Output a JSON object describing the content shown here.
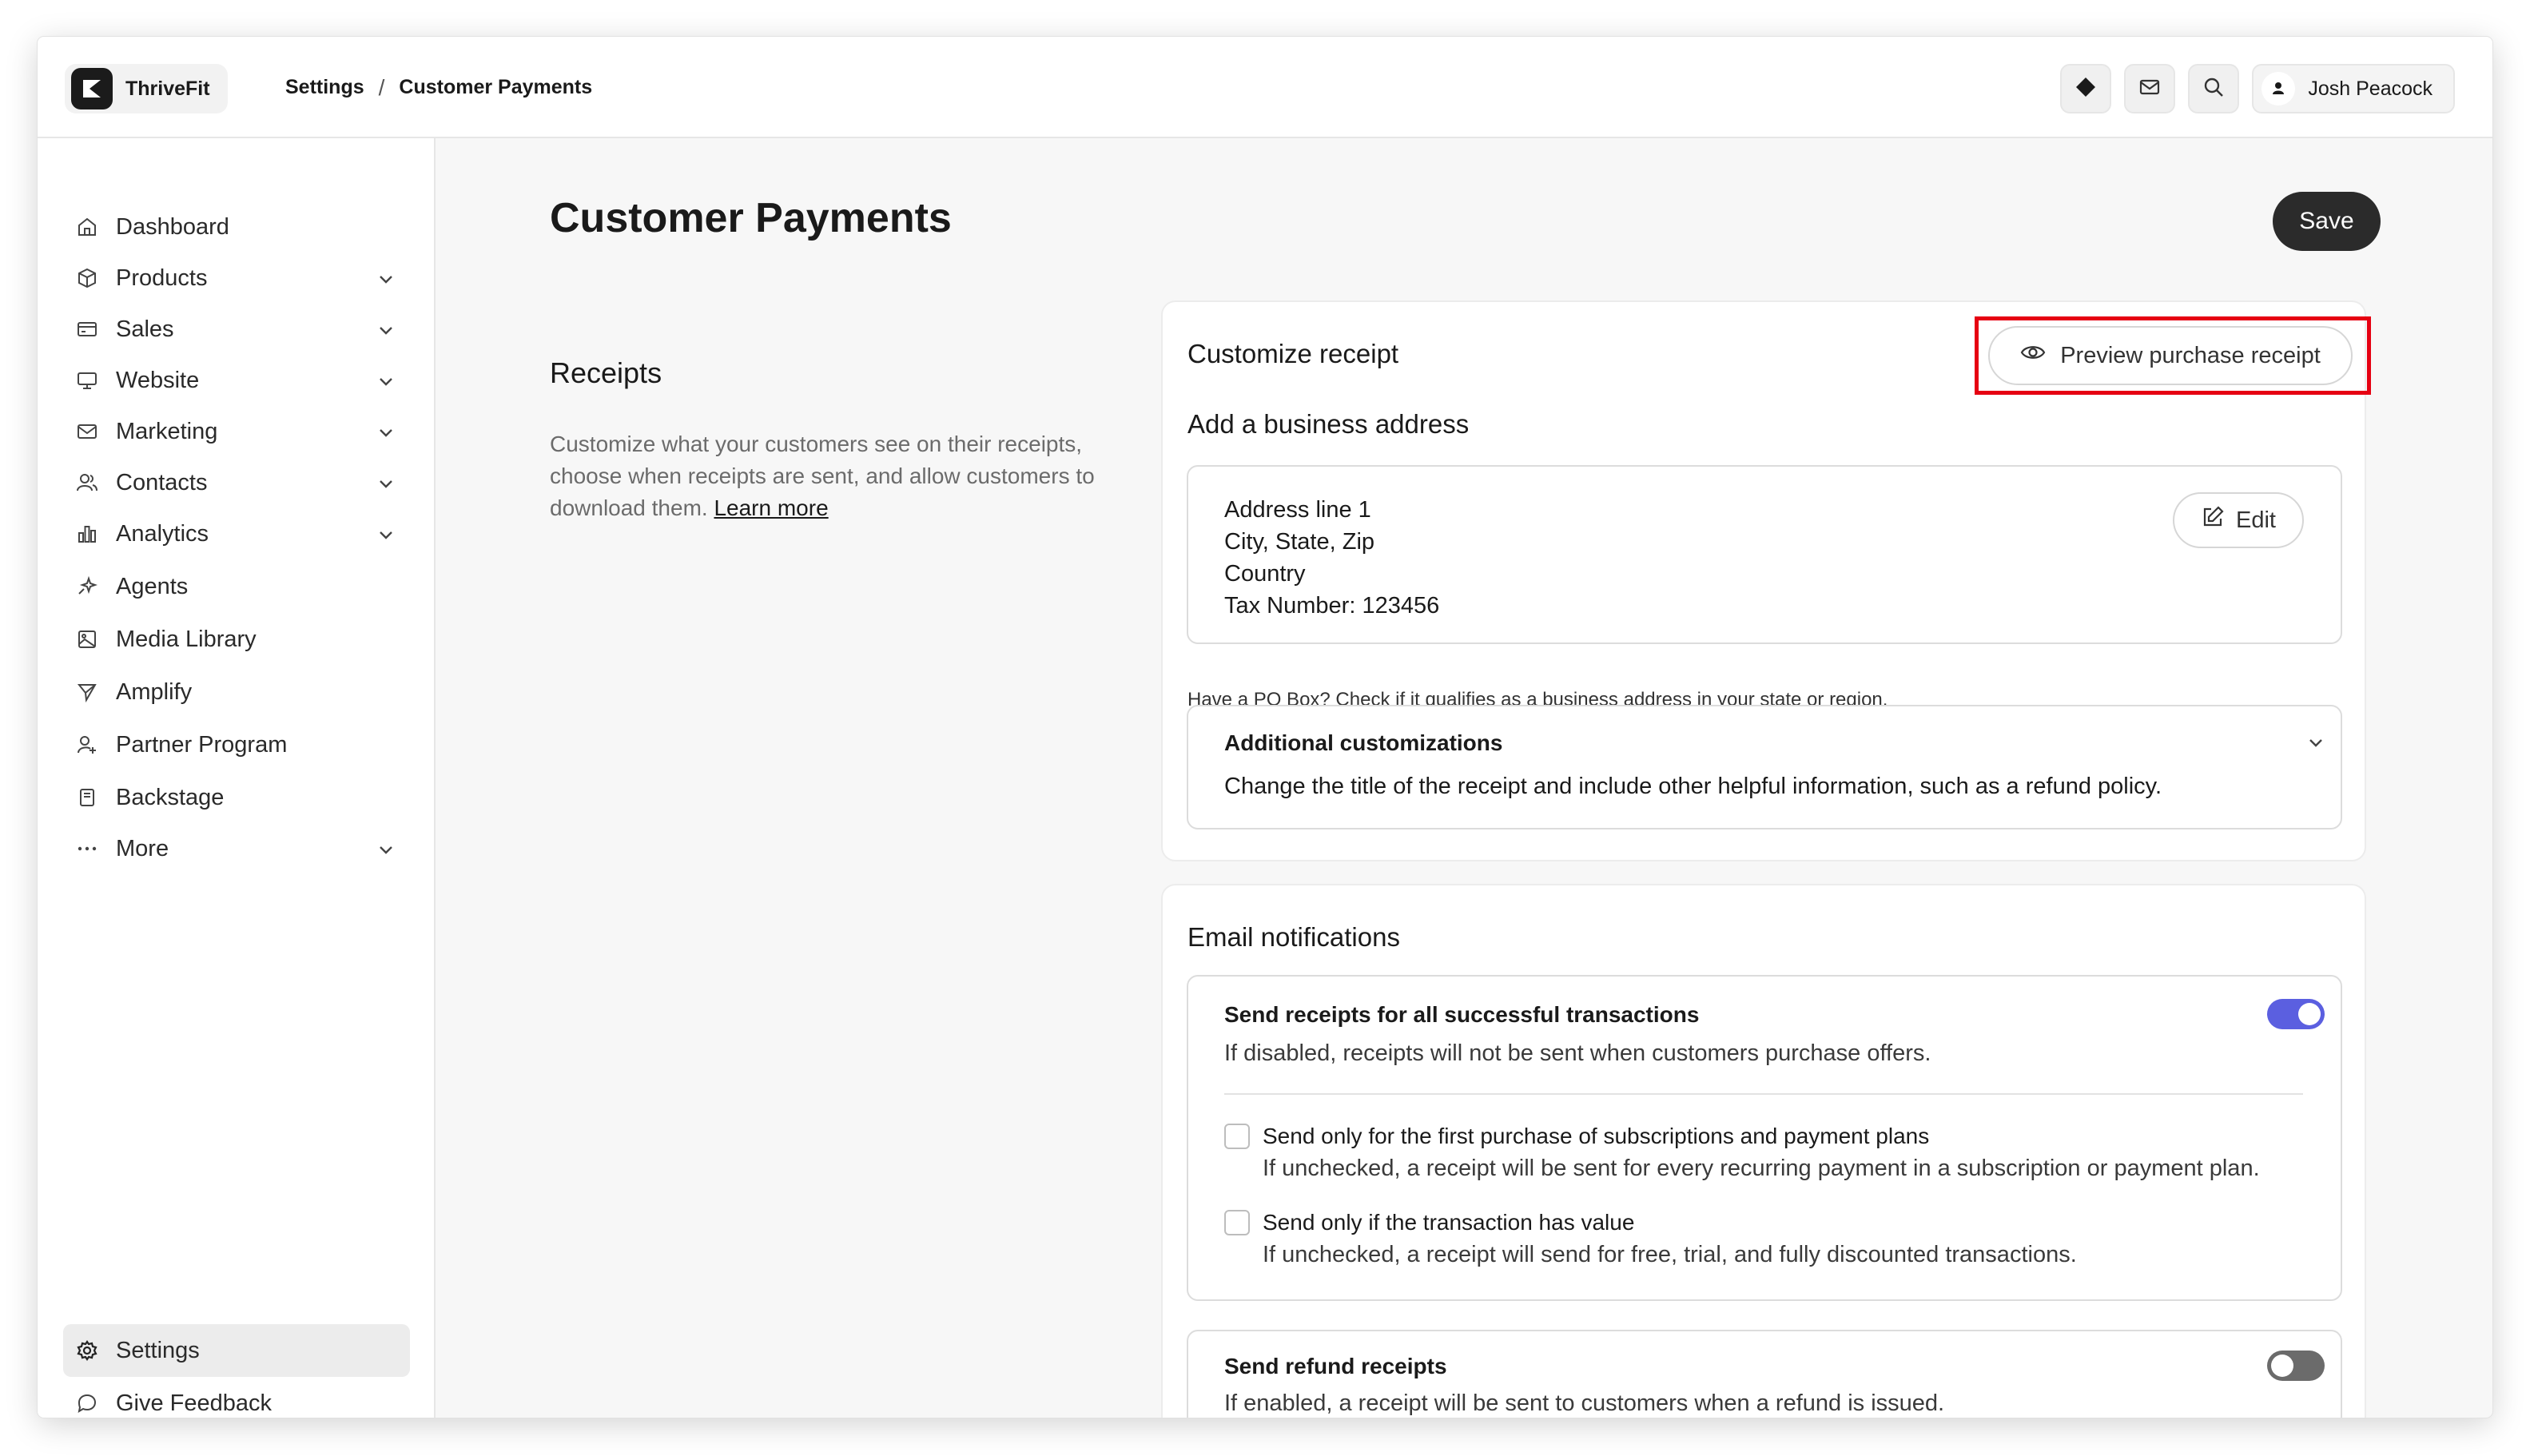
{
  "app": {
    "name": "ThriveFit"
  },
  "breadcrumb": {
    "items": [
      "Settings",
      "Customer Payments"
    ],
    "separator": "/"
  },
  "header": {
    "user_name": "Josh Peacock",
    "icons": [
      "diamond-icon",
      "mail-icon",
      "search-icon",
      "user-icon"
    ]
  },
  "sidebar": {
    "items": [
      {
        "label": "Dashboard",
        "icon": "home-icon",
        "chevron": false
      },
      {
        "label": "Products",
        "icon": "box-icon",
        "chevron": true
      },
      {
        "label": "Sales",
        "icon": "card-icon",
        "chevron": true
      },
      {
        "label": "Website",
        "icon": "monitor-icon",
        "chevron": true
      },
      {
        "label": "Marketing",
        "icon": "mail-icon",
        "chevron": true
      },
      {
        "label": "Contacts",
        "icon": "users-icon",
        "chevron": true
      },
      {
        "label": "Analytics",
        "icon": "chart-icon",
        "chevron": true
      },
      {
        "label": "Agents",
        "icon": "sparkle-icon",
        "chevron": false
      },
      {
        "label": "Media Library",
        "icon": "image-icon",
        "chevron": false
      },
      {
        "label": "Amplify",
        "icon": "send-icon",
        "chevron": false
      },
      {
        "label": "Partner Program",
        "icon": "partner-icon",
        "chevron": false
      },
      {
        "label": "Backstage",
        "icon": "book-icon",
        "chevron": false
      },
      {
        "label": "More",
        "icon": "more-icon",
        "chevron": true
      }
    ],
    "bottom": [
      {
        "label": "Settings",
        "icon": "gear-icon",
        "active": true
      },
      {
        "label": "Give Feedback",
        "icon": "chat-icon",
        "active": false
      }
    ]
  },
  "page": {
    "title": "Customer Payments",
    "save_label": "Save"
  },
  "receipts": {
    "title": "Receipts",
    "description": "Customize what your customers see on their receipts, choose when receipts are sent, and allow customers to download them.",
    "learn_more": "Learn more"
  },
  "customize": {
    "title": "Customize receipt",
    "preview_label": "Preview purchase receipt",
    "address_heading": "Add a business address",
    "address_lines": [
      "Address line 1",
      "City, State, Zip",
      "Country",
      "Tax Number: 123456"
    ],
    "edit_label": "Edit",
    "po_hint": "Have a PO Box? Check if it qualifies as a business address in your state or region.",
    "additional_title": "Additional customizations",
    "additional_desc": "Change the title of the receipt and include other helpful information, such as a refund policy."
  },
  "email": {
    "title": "Email notifications",
    "all_receipts_title": "Send receipts for all successful transactions",
    "all_receipts_desc": "If disabled, receipts will not be sent when customers purchase offers.",
    "all_receipts_enabled": true,
    "first_purchase_title": "Send only for the first purchase of subscriptions and payment plans",
    "first_purchase_desc": "If unchecked, a receipt will be sent for every recurring payment in a subscription or payment plan.",
    "first_purchase_checked": false,
    "has_value_title": "Send only if the transaction has value",
    "has_value_desc": "If unchecked, a receipt will send for free, trial, and fully discounted transactions.",
    "has_value_checked": false,
    "refund_title": "Send refund receipts",
    "refund_desc": "If enabled, a receipt will be sent to customers when a refund is issued.",
    "refund_enabled": false
  },
  "colors": {
    "toggle_on": "#5b5fe0",
    "toggle_off": "#6b6b6b",
    "highlight": "#e60012"
  }
}
